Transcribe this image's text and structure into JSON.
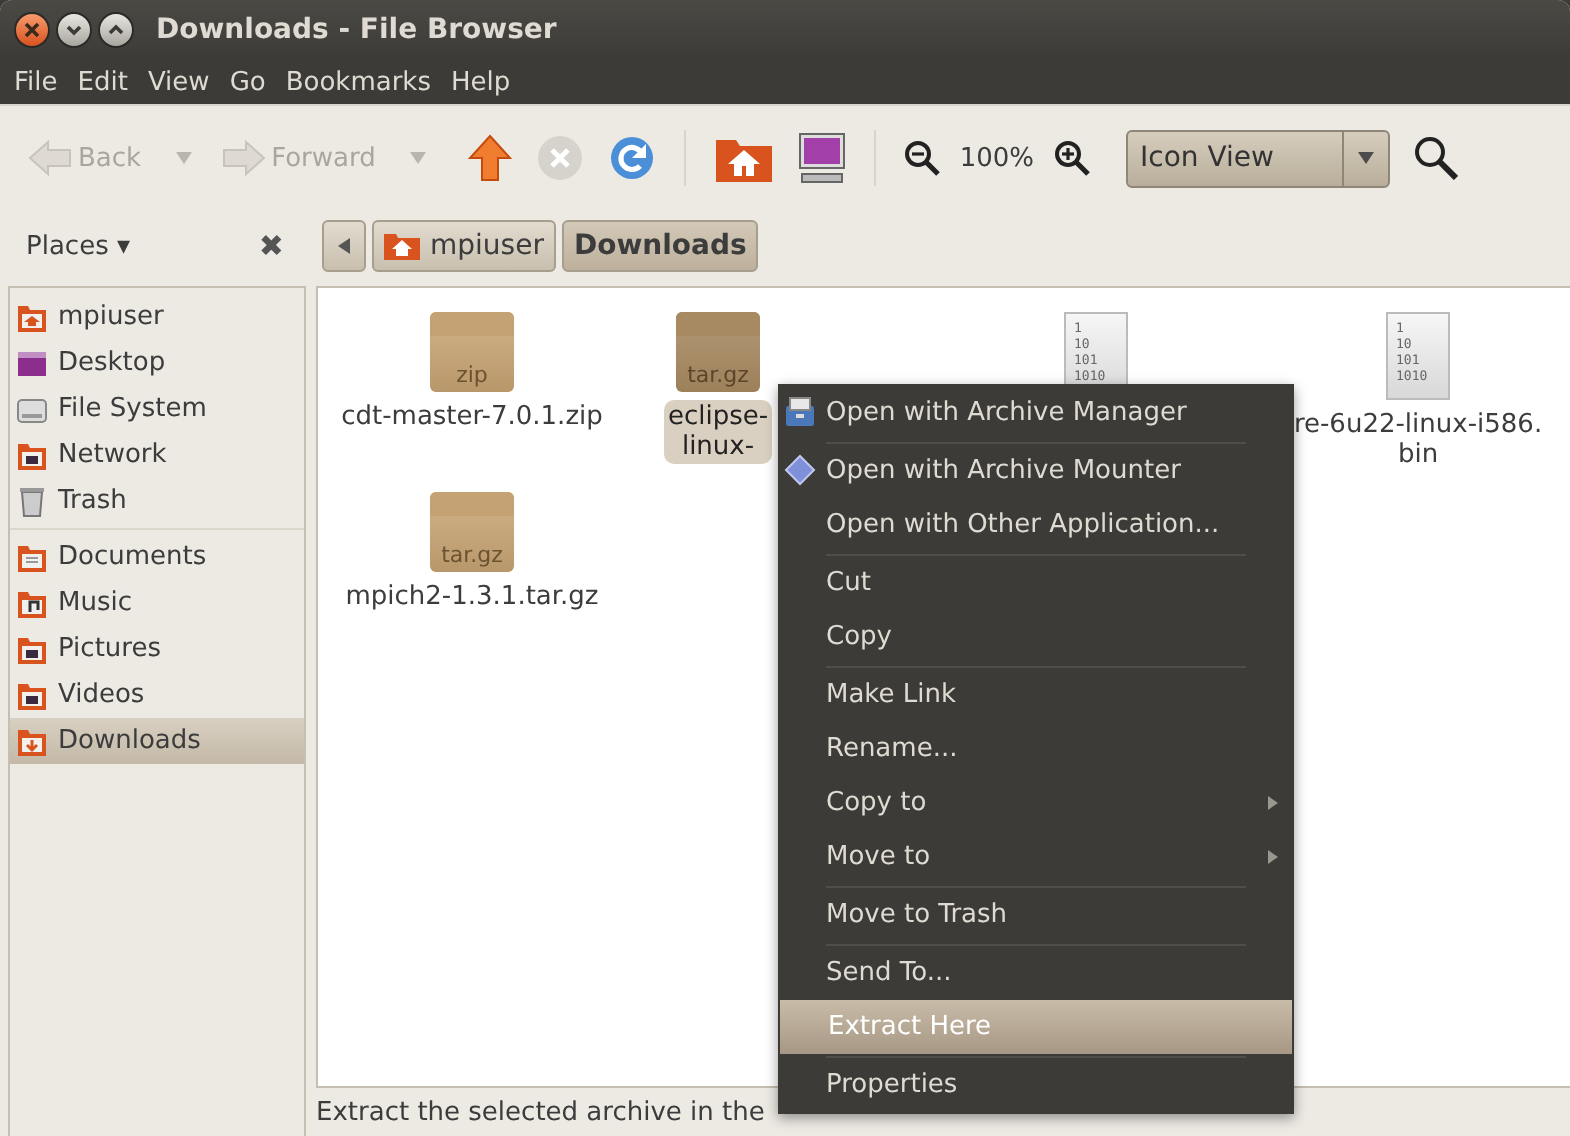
{
  "window": {
    "title": "Downloads - File Browser",
    "controls": [
      {
        "kind": "close"
      },
      {
        "kind": "minimize"
      },
      {
        "kind": "maximize"
      }
    ]
  },
  "menubar": [
    "File",
    "Edit",
    "View",
    "Go",
    "Bookmarks",
    "Help"
  ],
  "toolbar": [
    {
      "kind": "back",
      "label": "Back",
      "disabled": true
    },
    {
      "kind": "dropdown",
      "disabled": true
    },
    {
      "kind": "forward",
      "label": "Forward",
      "disabled": true
    },
    {
      "kind": "dropdown",
      "disabled": true
    },
    {
      "kind": "up",
      "disabled": false
    },
    {
      "kind": "stop",
      "disabled": true
    },
    {
      "kind": "reload",
      "disabled": false
    },
    {
      "kind": "separator"
    },
    {
      "kind": "home"
    },
    {
      "kind": "computer"
    },
    {
      "kind": "separator"
    },
    {
      "kind": "zoom-out"
    },
    {
      "kind": "zoom-level",
      "label": "100%"
    },
    {
      "kind": "zoom-in"
    },
    {
      "kind": "view-combo",
      "label": "Icon View"
    },
    {
      "kind": "search"
    }
  ],
  "sidebar": {
    "title": "Places",
    "title_caret": "▾",
    "close": "✖",
    "groups": [
      [
        {
          "label": "mpiuser",
          "kind": "home",
          "selected": false
        },
        {
          "label": "Desktop",
          "kind": "desktop",
          "selected": false
        },
        {
          "label": "File System",
          "kind": "drive",
          "selected": false
        },
        {
          "label": "Network",
          "kind": "network",
          "selected": false
        },
        {
          "label": "Trash",
          "kind": "trash",
          "selected": false
        }
      ],
      [
        {
          "label": "Documents",
          "kind": "documents",
          "selected": false
        },
        {
          "label": "Music",
          "kind": "music",
          "selected": false
        },
        {
          "label": "Pictures",
          "kind": "pictures",
          "selected": false
        },
        {
          "label": "Videos",
          "kind": "videos",
          "selected": false
        },
        {
          "label": "Downloads",
          "kind": "downloads",
          "selected": true
        }
      ]
    ]
  },
  "path_bar": [
    {
      "label": "mpiuser",
      "kind": "home",
      "selected": false
    },
    {
      "label": "Downloads",
      "kind": "plain",
      "selected": true
    }
  ],
  "files": [
    {
      "kind": "archive",
      "badge": "zip",
      "name": [
        "cdt-master-7.0.1.zip"
      ],
      "selected": false
    },
    {
      "kind": "archive",
      "badge": "tar.gz",
      "name": [
        "eclipse-",
        "linux-"
      ],
      "selected": true
    },
    {
      "kind": "binary",
      "icon_text": [
        "1",
        "10",
        "101",
        "1010"
      ]
    },
    {
      "kind": "binary",
      "icon_text": [
        "1",
        "10",
        "101",
        "1010"
      ],
      "name": [
        "re-6u22-linux-i586.",
        "bin"
      ],
      "selected": false
    },
    {
      "kind": "archive",
      "badge": "tar.gz",
      "name": [
        "mpich2-1.3.1.tar.gz"
      ],
      "selected": false
    }
  ],
  "context_menu": [
    {
      "kind": "archiver",
      "label": "Open with Archive Manager",
      "highlighted": false
    },
    {
      "kind": "separator"
    },
    {
      "kind": "mounter",
      "label": "Open with Archive Mounter",
      "highlighted": false
    },
    {
      "kind": "item",
      "label": "Open with Other Application...",
      "highlighted": false
    },
    {
      "kind": "separator"
    },
    {
      "kind": "item",
      "label": "Cut",
      "highlighted": false
    },
    {
      "kind": "item",
      "label": "Copy",
      "highlighted": false
    },
    {
      "kind": "separator"
    },
    {
      "kind": "item",
      "label": "Make Link",
      "highlighted": false
    },
    {
      "kind": "item",
      "label": "Rename...",
      "highlighted": false
    },
    {
      "kind": "item",
      "label": "Copy to",
      "submenu": true,
      "highlighted": false
    },
    {
      "kind": "item",
      "label": "Move to",
      "submenu": true,
      "highlighted": false
    },
    {
      "kind": "separator"
    },
    {
      "kind": "item",
      "label": "Move to Trash",
      "highlighted": false
    },
    {
      "kind": "separator"
    },
    {
      "kind": "item",
      "label": "Send To...",
      "highlighted": false
    },
    {
      "kind": "item",
      "label": "Extract Here",
      "highlighted": true
    },
    {
      "kind": "separator"
    },
    {
      "kind": "item",
      "label": "Properties",
      "highlighted": false
    }
  ],
  "status_bar": "Extract the selected archive in the"
}
